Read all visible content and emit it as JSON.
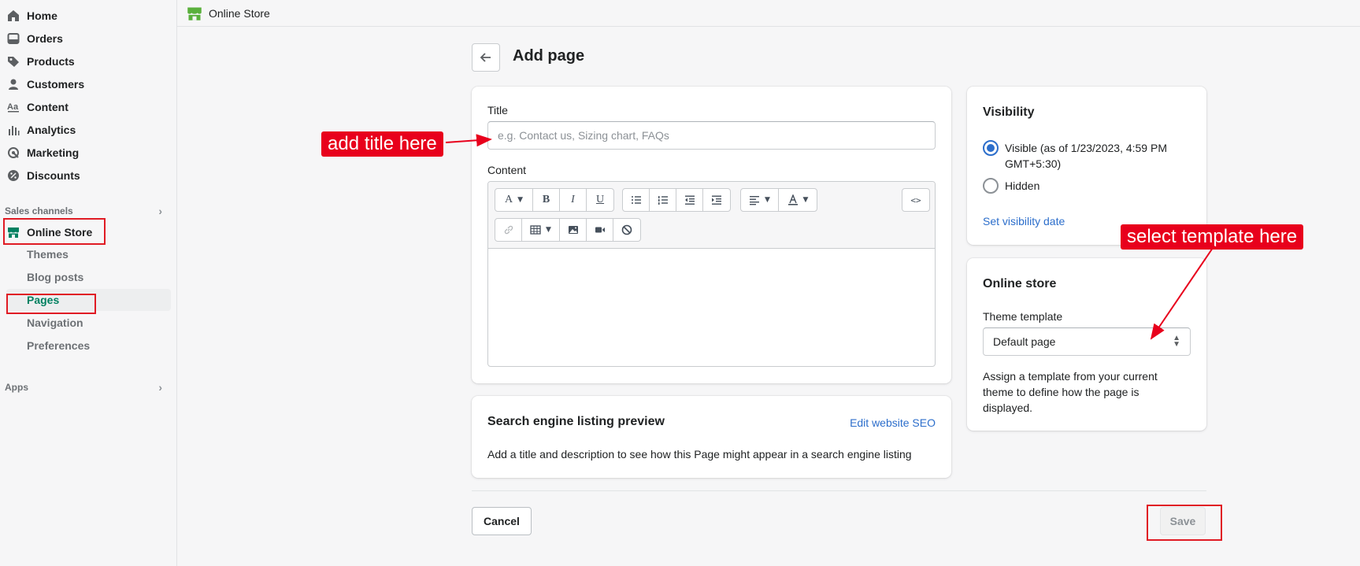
{
  "sidebar": {
    "items": [
      {
        "label": "Home",
        "icon": "home-icon"
      },
      {
        "label": "Orders",
        "icon": "inbox-icon"
      },
      {
        "label": "Products",
        "icon": "tag-icon"
      },
      {
        "label": "Customers",
        "icon": "person-icon"
      },
      {
        "label": "Content",
        "icon": "text-icon"
      },
      {
        "label": "Analytics",
        "icon": "bar-chart-icon"
      },
      {
        "label": "Marketing",
        "icon": "target-icon"
      },
      {
        "label": "Discounts",
        "icon": "discount-icon"
      }
    ],
    "sales_channels_label": "Sales channels",
    "online_store": {
      "label": "Online Store",
      "icon": "store-icon"
    },
    "sub_items": [
      "Themes",
      "Blog posts",
      "Pages",
      "Navigation",
      "Preferences"
    ],
    "active_sub_item": "Pages",
    "apps_label": "Apps"
  },
  "topbar": {
    "title": "Online Store",
    "icon": "store-icon"
  },
  "header": {
    "title": "Add page"
  },
  "main_card": {
    "title_label": "Title",
    "title_placeholder": "e.g. Contact us, Sizing chart, FAQs",
    "content_label": "Content",
    "toolbar_row1": [
      "A",
      "B",
      "I",
      "U"
    ],
    "html_button": "<>"
  },
  "seo_card": {
    "heading": "Search engine listing preview",
    "edit_link": "Edit website SEO",
    "description": "Add a title and description to see how this Page might appear in a search engine listing"
  },
  "visibility_card": {
    "heading": "Visibility",
    "visible_label": "Visible (as of 1/23/2023, 4:59 PM GMT+5:30)",
    "hidden_label": "Hidden",
    "selected": "Visible",
    "set_date_link": "Set visibility date"
  },
  "online_store_card": {
    "heading": "Online store",
    "template_label": "Theme template",
    "template_value": "Default page",
    "help_text": "Assign a template from your current theme to define how the page is displayed."
  },
  "footer": {
    "cancel_label": "Cancel",
    "save_label": "Save"
  },
  "annotations": {
    "title_callout": "add title here",
    "template_callout": "select template here"
  },
  "colors": {
    "accent_green": "#008060",
    "link_blue": "#2c6ecb",
    "annotation_red": "#e8001c"
  }
}
